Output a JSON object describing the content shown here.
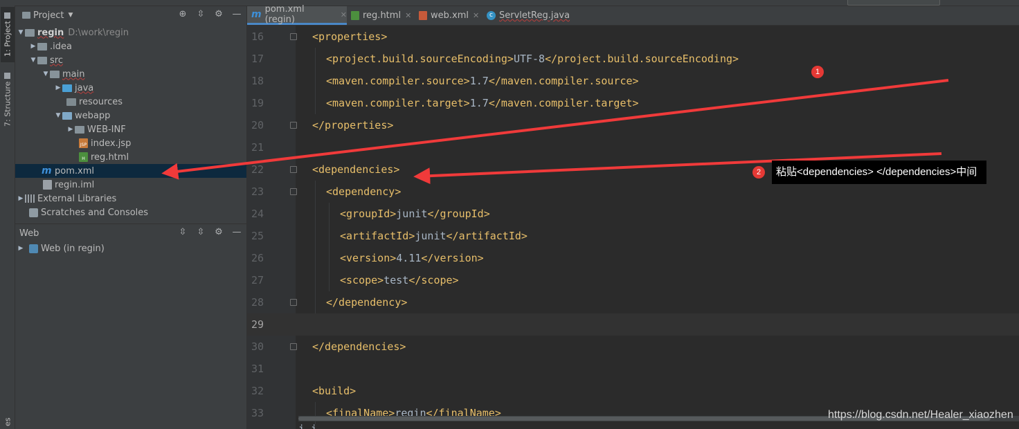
{
  "tool_windows": {
    "project_tab": "1: Project",
    "structure_tab": "7: Structure",
    "bottom_tab": "es"
  },
  "project_panel": {
    "title": "Project"
  },
  "tree": [
    {
      "label": "regin",
      "hint": "D:\\work\\regin",
      "icon": "module-folder-icon"
    },
    {
      "label": ".idea",
      "icon": "folder-icon"
    },
    {
      "label": "src",
      "icon": "folder-icon"
    },
    {
      "label": "main",
      "icon": "folder-icon"
    },
    {
      "label": "java",
      "icon": "source-folder-icon"
    },
    {
      "label": "resources",
      "icon": "resources-folder-icon"
    },
    {
      "label": "webapp",
      "icon": "web-folder-icon"
    },
    {
      "label": "WEB-INF",
      "icon": "folder-icon"
    },
    {
      "label": "index.jsp",
      "icon": "jsp-file-icon",
      "icon_text": "JSP"
    },
    {
      "label": "reg.html",
      "icon": "html-file-icon",
      "icon_text": "H"
    },
    {
      "label": "pom.xml",
      "icon": "maven-icon"
    },
    {
      "label": "regin.iml",
      "icon": "iml-file-icon"
    },
    {
      "label": "External Libraries",
      "icon": "library-icon"
    },
    {
      "label": "Scratches and Consoles",
      "icon": "scratches-icon"
    }
  ],
  "web_panel": {
    "title": "Web",
    "item": "Web (in regin)"
  },
  "tabs": [
    {
      "label": "pom.xml (regin)",
      "icon": "maven-icon",
      "active": true
    },
    {
      "label": "reg.html",
      "icon": "html-file-icon"
    },
    {
      "label": "web.xml",
      "icon": "xml-file-icon"
    },
    {
      "label": "ServletReg.java",
      "icon": "class-icon"
    }
  ],
  "editor": {
    "current_line": "29",
    "lines": [
      {
        "n": "16",
        "t": "<properties>",
        "indent": 1
      },
      {
        "n": "17",
        "t": "<project.build.sourceEncoding>UTF-8</project.build.sourceEncoding>",
        "indent": 2
      },
      {
        "n": "18",
        "t": "<maven.compiler.source>1.7</maven.compiler.source>",
        "indent": 2
      },
      {
        "n": "19",
        "t": "<maven.compiler.target>1.7</maven.compiler.target>",
        "indent": 2
      },
      {
        "n": "20",
        "t": "</properties>",
        "indent": 1
      },
      {
        "n": "21",
        "t": "",
        "indent": 1
      },
      {
        "n": "22",
        "t": "<dependencies>",
        "indent": 1
      },
      {
        "n": "23",
        "t": "<dependency>",
        "indent": 2
      },
      {
        "n": "24",
        "t": "<groupId>junit</groupId>",
        "indent": 3
      },
      {
        "n": "25",
        "t": "<artifactId>junit</artifactId>",
        "indent": 3
      },
      {
        "n": "26",
        "t": "<version>4.11</version>",
        "indent": 3
      },
      {
        "n": "27",
        "t": "<scope>test</scope>",
        "indent": 3
      },
      {
        "n": "28",
        "t": "</dependency>",
        "indent": 2
      },
      {
        "n": "29",
        "t": "",
        "indent": 1
      },
      {
        "n": "30",
        "t": "</dependencies>",
        "indent": 1
      },
      {
        "n": "31",
        "t": "",
        "indent": 1
      },
      {
        "n": "32",
        "t": "<build>",
        "indent": 1
      },
      {
        "n": "33",
        "t": "<finalName>regin</finalName>",
        "indent": 2
      }
    ]
  },
  "annotations": {
    "badge1": "1",
    "badge2": "2",
    "note2": "粘贴<dependencies> </dependencies>中间",
    "arrow_color": "#f03a3a"
  },
  "watermark": "https://blog.csdn.net/Healer_xiaozhen"
}
